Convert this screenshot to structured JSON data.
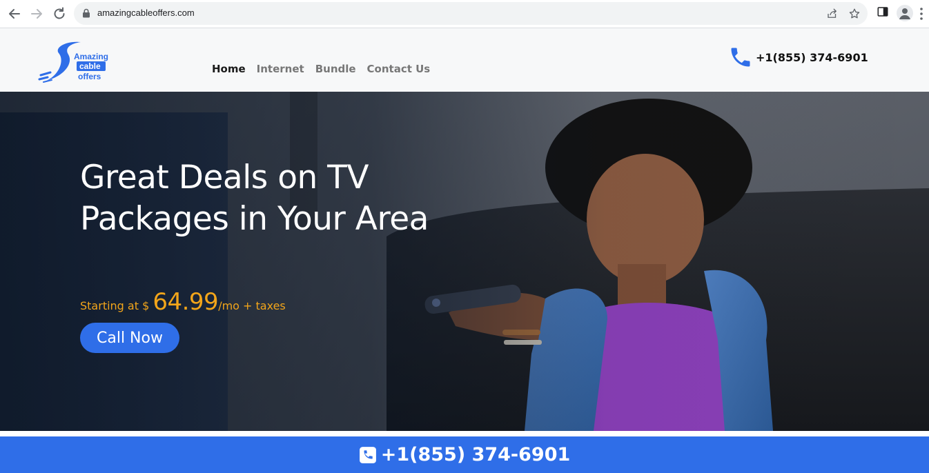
{
  "browser": {
    "url": "amazingcableoffers.com",
    "icons": [
      "back-arrow-icon",
      "forward-arrow-icon",
      "reload-icon",
      "lock-icon",
      "share-icon",
      "star-icon",
      "side-panel-icon",
      "profile-icon",
      "more-menu-icon"
    ]
  },
  "header": {
    "logo": {
      "line1": "Amazing",
      "line2": "cable",
      "line3": "offers"
    },
    "nav": [
      {
        "label": "Home",
        "active": true
      },
      {
        "label": "Internet",
        "active": false
      },
      {
        "label": "Bundle",
        "active": false
      },
      {
        "label": "Contact Us",
        "active": false
      }
    ],
    "phone": "+1(855) 374-6901"
  },
  "hero": {
    "title": "Great Deals on TV Packages in Your Area",
    "price_prefix": "Starting at $ ",
    "price_amount": "64.99",
    "price_suffix": "/mo + taxes",
    "cta_label": "Call Now"
  },
  "bottom_bar": {
    "phone": "+1(855) 374-6901"
  },
  "colors": {
    "brand_blue": "#2f6ee8",
    "price_orange": "#f2a51a",
    "nav_active": "#1a1a1a",
    "nav_inactive": "#777777"
  }
}
